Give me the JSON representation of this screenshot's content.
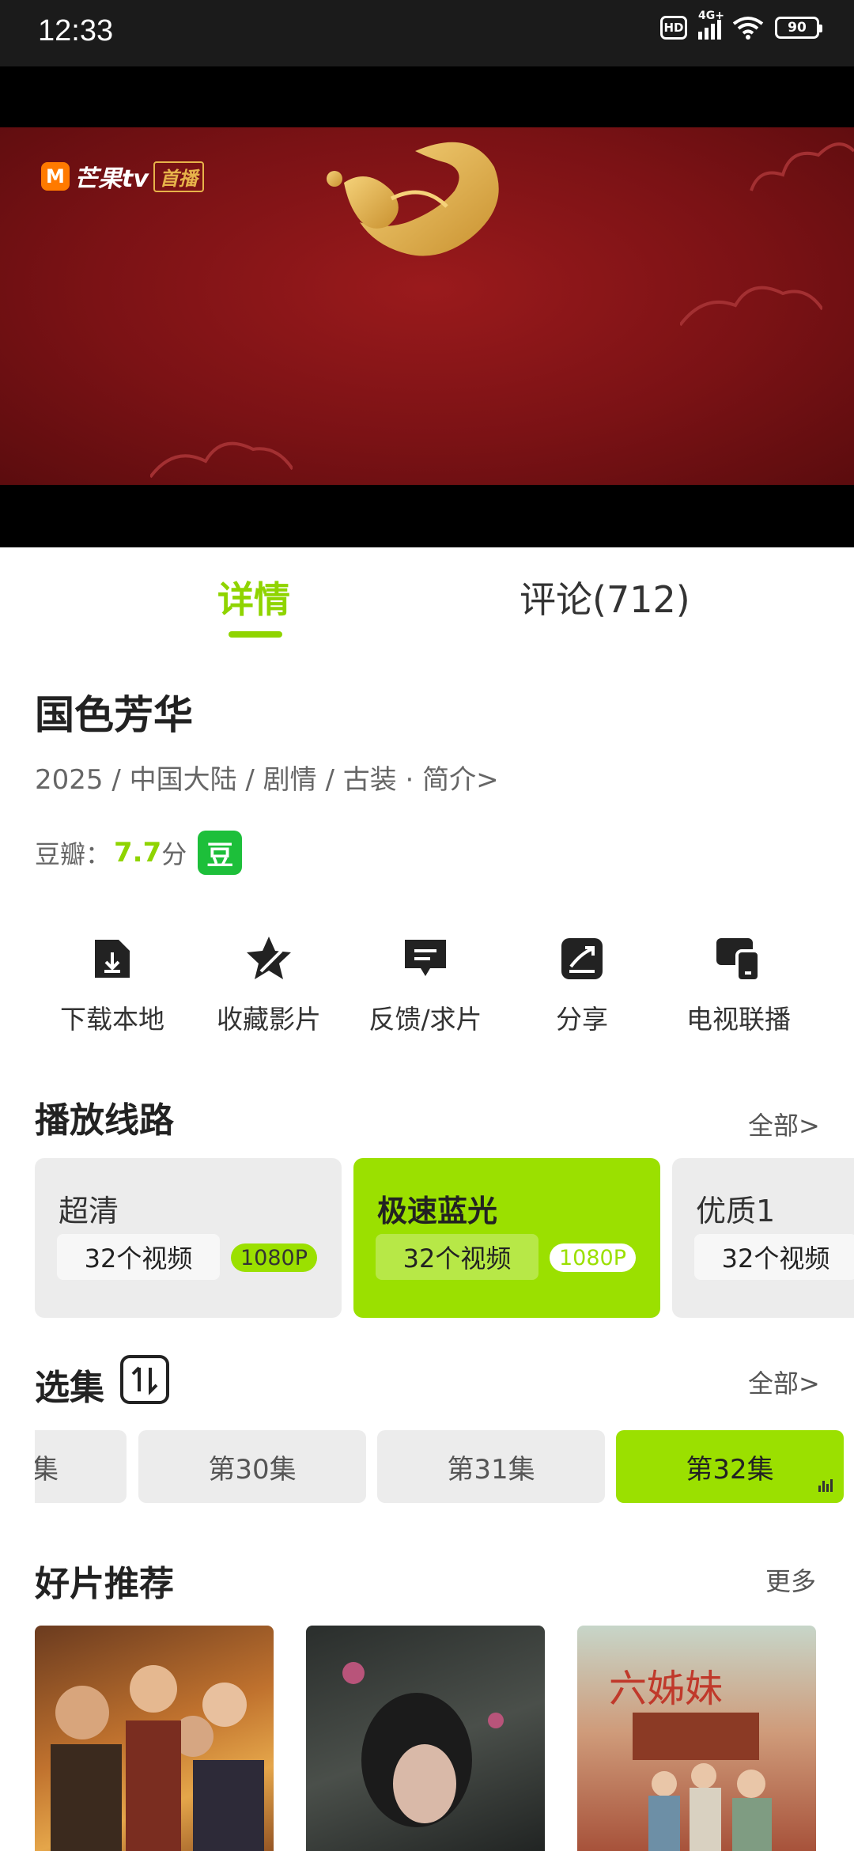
{
  "status_bar": {
    "time": "12:33",
    "hd": "HD",
    "network": "4G+",
    "battery": "90"
  },
  "video": {
    "brand": "芒果tv",
    "badge": "首播"
  },
  "tabs": {
    "details": "详情",
    "comments": "评论(712)"
  },
  "show": {
    "title": "国色芳华",
    "meta": "2025 / 中国大陆 / 剧情 / 古装 · 简介>",
    "rating_label": "豆瓣：",
    "rating_score": "7.7",
    "rating_unit": "分",
    "douban_icon": "豆"
  },
  "actions": [
    {
      "icon": "download-icon",
      "label": "下载本地"
    },
    {
      "icon": "star-icon",
      "label": "收藏影片"
    },
    {
      "icon": "feedback-icon",
      "label": "反馈/求片"
    },
    {
      "icon": "share-icon",
      "label": "分享"
    },
    {
      "icon": "tv-cast-icon",
      "label": "电视联播"
    }
  ],
  "play_lines": {
    "title": "播放线路",
    "all": "全部>",
    "items": [
      {
        "name": "超清",
        "count": "32个视频",
        "resolution": "1080P",
        "active": false
      },
      {
        "name": "极速蓝光",
        "count": "32个视频",
        "resolution": "1080P",
        "active": true
      },
      {
        "name": "优质1",
        "count": "32个视频",
        "resolution": "",
        "active": false
      }
    ]
  },
  "episodes": {
    "title": "选集",
    "all": "全部>",
    "items": [
      "集",
      "第30集",
      "第31集",
      "第32集"
    ],
    "current": "第32集"
  },
  "recommend": {
    "title": "好片推荐",
    "more": "更多",
    "poster_text": "六姊妹"
  },
  "colors": {
    "accent": "#9be000",
    "accent_text": "#8fd400",
    "video_bg": "#7b1215"
  }
}
